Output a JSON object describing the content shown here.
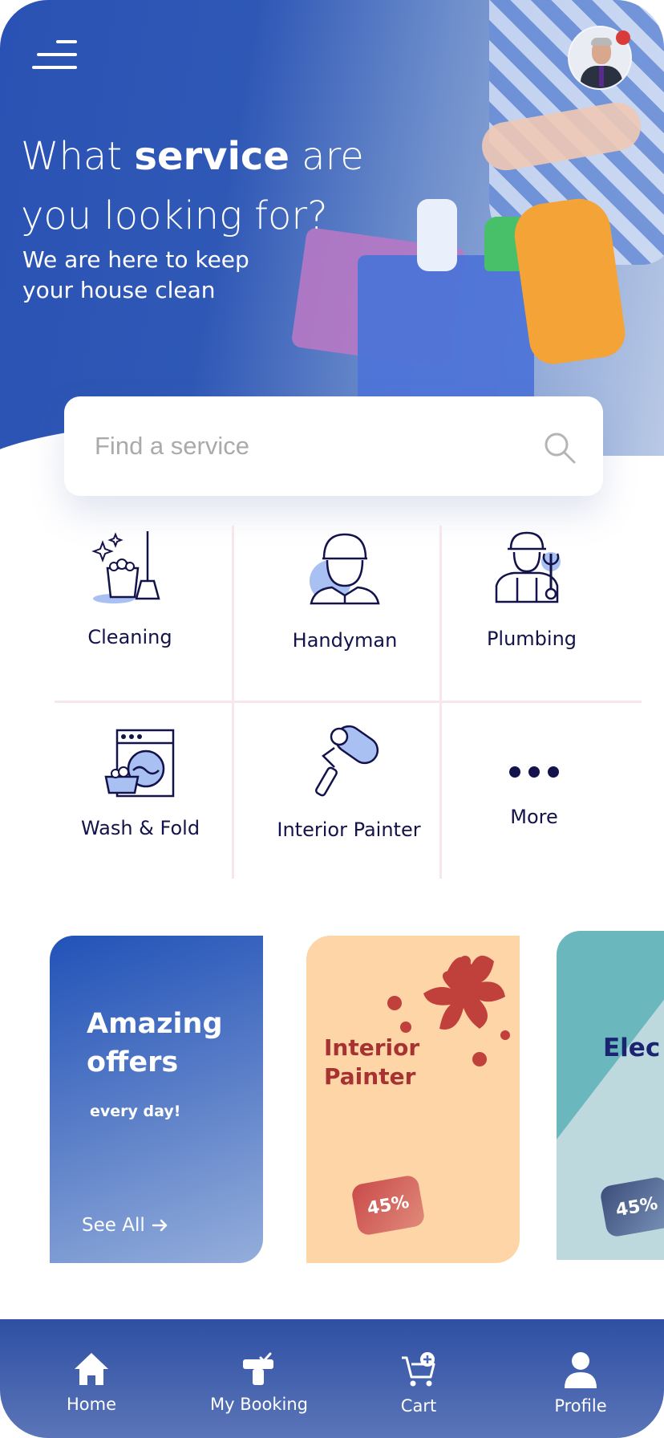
{
  "hero": {
    "title_pre": "What ",
    "title_bold": "service",
    "title_post": " are you looking for?",
    "subtitle": "We are here to keep your house clean"
  },
  "search": {
    "placeholder": "Find a service"
  },
  "categories": [
    {
      "label": "Cleaning",
      "icon": "cleaning-icon"
    },
    {
      "label": "Handyman",
      "icon": "handyman-icon"
    },
    {
      "label": "Plumbing",
      "icon": "plumbing-icon"
    },
    {
      "label": "Wash & Fold",
      "icon": "washing-machine-icon"
    },
    {
      "label": "Interior Painter",
      "icon": "paint-roller-icon"
    },
    {
      "label": "More",
      "icon": "more-dots-icon"
    }
  ],
  "promos": {
    "offers": {
      "title": "Amazing offers",
      "subtitle": "every day!",
      "link": "See All"
    },
    "painter": {
      "title": "Interior Painter",
      "badge": "45%"
    },
    "electric": {
      "title": "Elec",
      "badge": "45%"
    }
  },
  "nav": [
    {
      "label": "Home",
      "icon": "home-icon"
    },
    {
      "label": "My Booking",
      "icon": "booking-icon"
    },
    {
      "label": "Cart",
      "icon": "cart-icon"
    },
    {
      "label": "Profile",
      "icon": "profile-icon"
    }
  ],
  "colors": {
    "primary": "#2a52b4",
    "text_dark": "#13124a",
    "accent_red": "#d93a3a",
    "painter_bg": "#fdd5a6",
    "electric_bg": "#bdd9de"
  }
}
